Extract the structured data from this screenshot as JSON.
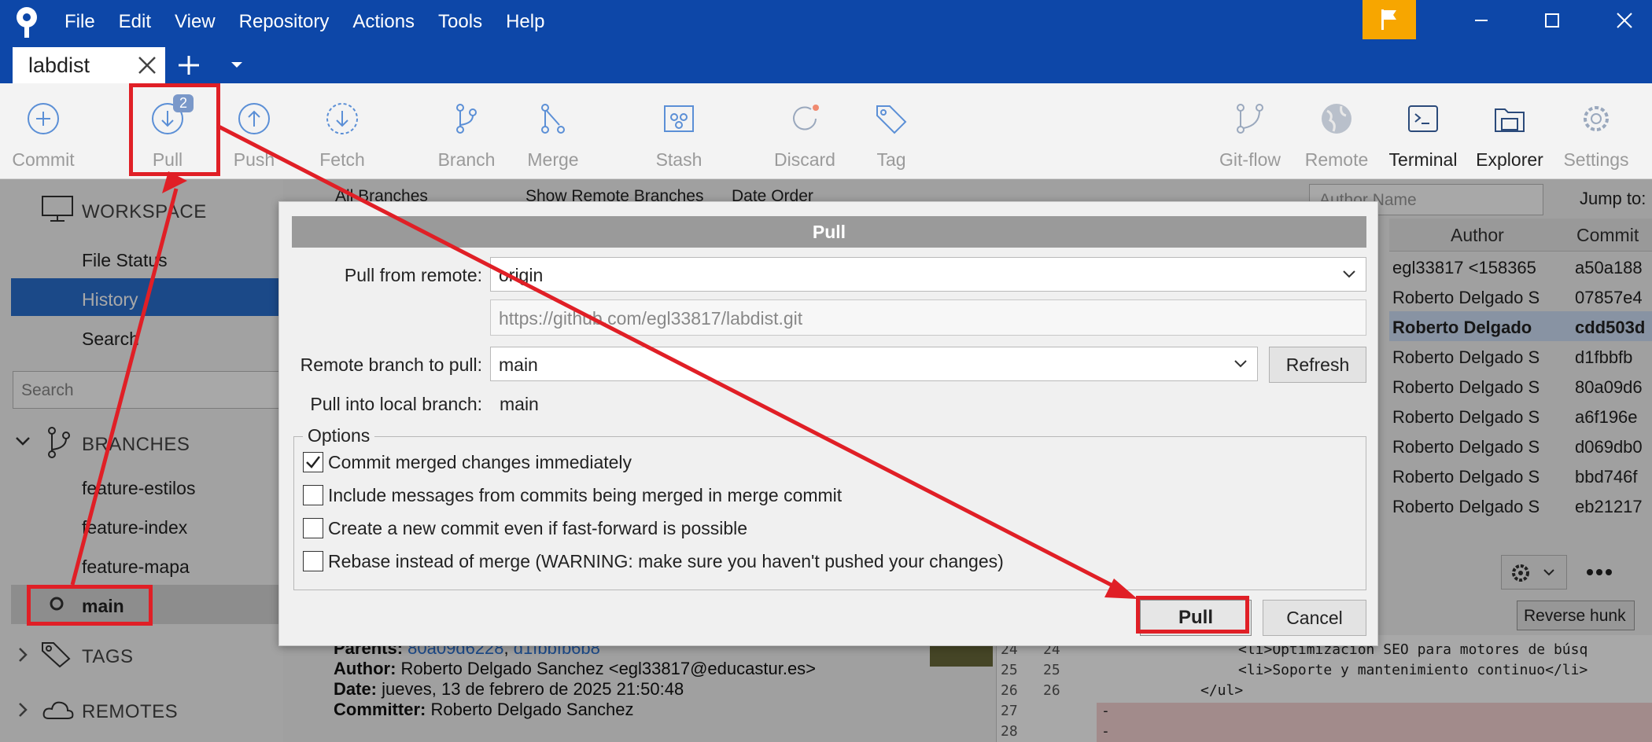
{
  "menu": [
    "File",
    "Edit",
    "View",
    "Repository",
    "Actions",
    "Tools",
    "Help"
  ],
  "tab": {
    "label": "labdist"
  },
  "toolbar": {
    "commit": "Commit",
    "pull": "Pull",
    "pull_badge": "2",
    "push": "Push",
    "fetch": "Fetch",
    "branch": "Branch",
    "merge": "Merge",
    "stash": "Stash",
    "discard": "Discard",
    "tag": "Tag",
    "gitflow": "Git-flow",
    "remote": "Remote",
    "terminal": "Terminal",
    "explorer": "Explorer",
    "settings": "Settings"
  },
  "sidebar": {
    "workspace": "WORKSPACE",
    "file_status": "File Status",
    "history": "History",
    "search": "Search",
    "search_placeholder": "Search",
    "branches": "BRANCHES",
    "branch_items": [
      "feature-estilos",
      "feature-index",
      "feature-mapa",
      "main"
    ],
    "tags": "TAGS",
    "remotes": "REMOTES"
  },
  "history_view": {
    "branches_filter": "All Branches",
    "show_remote": "Show Remote Branches",
    "order": "Date Order",
    "author_placeholder": "Author Name",
    "jump_to": "Jump to:",
    "col_author": "Author",
    "col_commit": "Commit",
    "authors": [
      "egl33817 <158365",
      "Roberto Delgado S",
      "Roberto Delgado",
      "Roberto Delgado S",
      "Roberto Delgado S",
      "Roberto Delgado S",
      "Roberto Delgado S",
      "Roberto Delgado S",
      "Roberto Delgado S"
    ],
    "hashes": [
      "a50a188",
      "07857e4",
      "cdd503d",
      "d1fbbfb",
      "80a09d6",
      "a6f196e",
      "d069db0",
      "bbd746f",
      "eb21217"
    ]
  },
  "commit_detail": {
    "parents_label": "Parents:",
    "parent1": "80a09d6228",
    "parent_sep": ",",
    "parent2": "d1fbbfb6b8",
    "author_label": "Author:",
    "author": "Roberto Delgado Sanchez <egl33817@educastur.es>",
    "date_label": "Date:",
    "date": "jueves, 13 de febrero de 2025 21:50:48",
    "committer_label": "Committer:",
    "committer": "Roberto Delgado Sanchez"
  },
  "diff": {
    "reverse_hunk": "Reverse hunk",
    "lines": [
      {
        "a": "24",
        "b": "24",
        "text": "<li>Optimización SEO para motores de búsq"
      },
      {
        "a": "25",
        "b": "25",
        "text": "<li>Soporte y mantenimiento continuo</li>"
      },
      {
        "a": "26",
        "b": "26",
        "text": "</ul>"
      },
      {
        "a": "27",
        "b": "",
        "text": "-"
      },
      {
        "a": "28",
        "b": "",
        "text": "-"
      }
    ]
  },
  "dialog": {
    "title": "Pull",
    "pull_from_remote_label": "Pull from remote:",
    "remote_value": "origin",
    "remote_url": "https://github.com/egl33817/labdist.git",
    "remote_branch_label": "Remote branch to pull:",
    "remote_branch_value": "main",
    "refresh": "Refresh",
    "local_branch_label": "Pull into local branch:",
    "local_branch_value": "main",
    "options_legend": "Options",
    "options": [
      {
        "label": "Commit merged changes immediately",
        "checked": true
      },
      {
        "label": "Include messages from commits being merged in merge commit",
        "checked": false
      },
      {
        "label": "Create a new commit even if fast-forward is possible",
        "checked": false
      },
      {
        "label": "Rebase instead of merge (WARNING: make sure you haven't pushed your changes)",
        "checked": false
      }
    ],
    "pull_button": "Pull",
    "cancel_button": "Cancel"
  },
  "colors": {
    "titlebar": "#0d47a8",
    "flag": "#f7a600",
    "annotation": "#e01f26",
    "selected": "#2a6fcf"
  }
}
